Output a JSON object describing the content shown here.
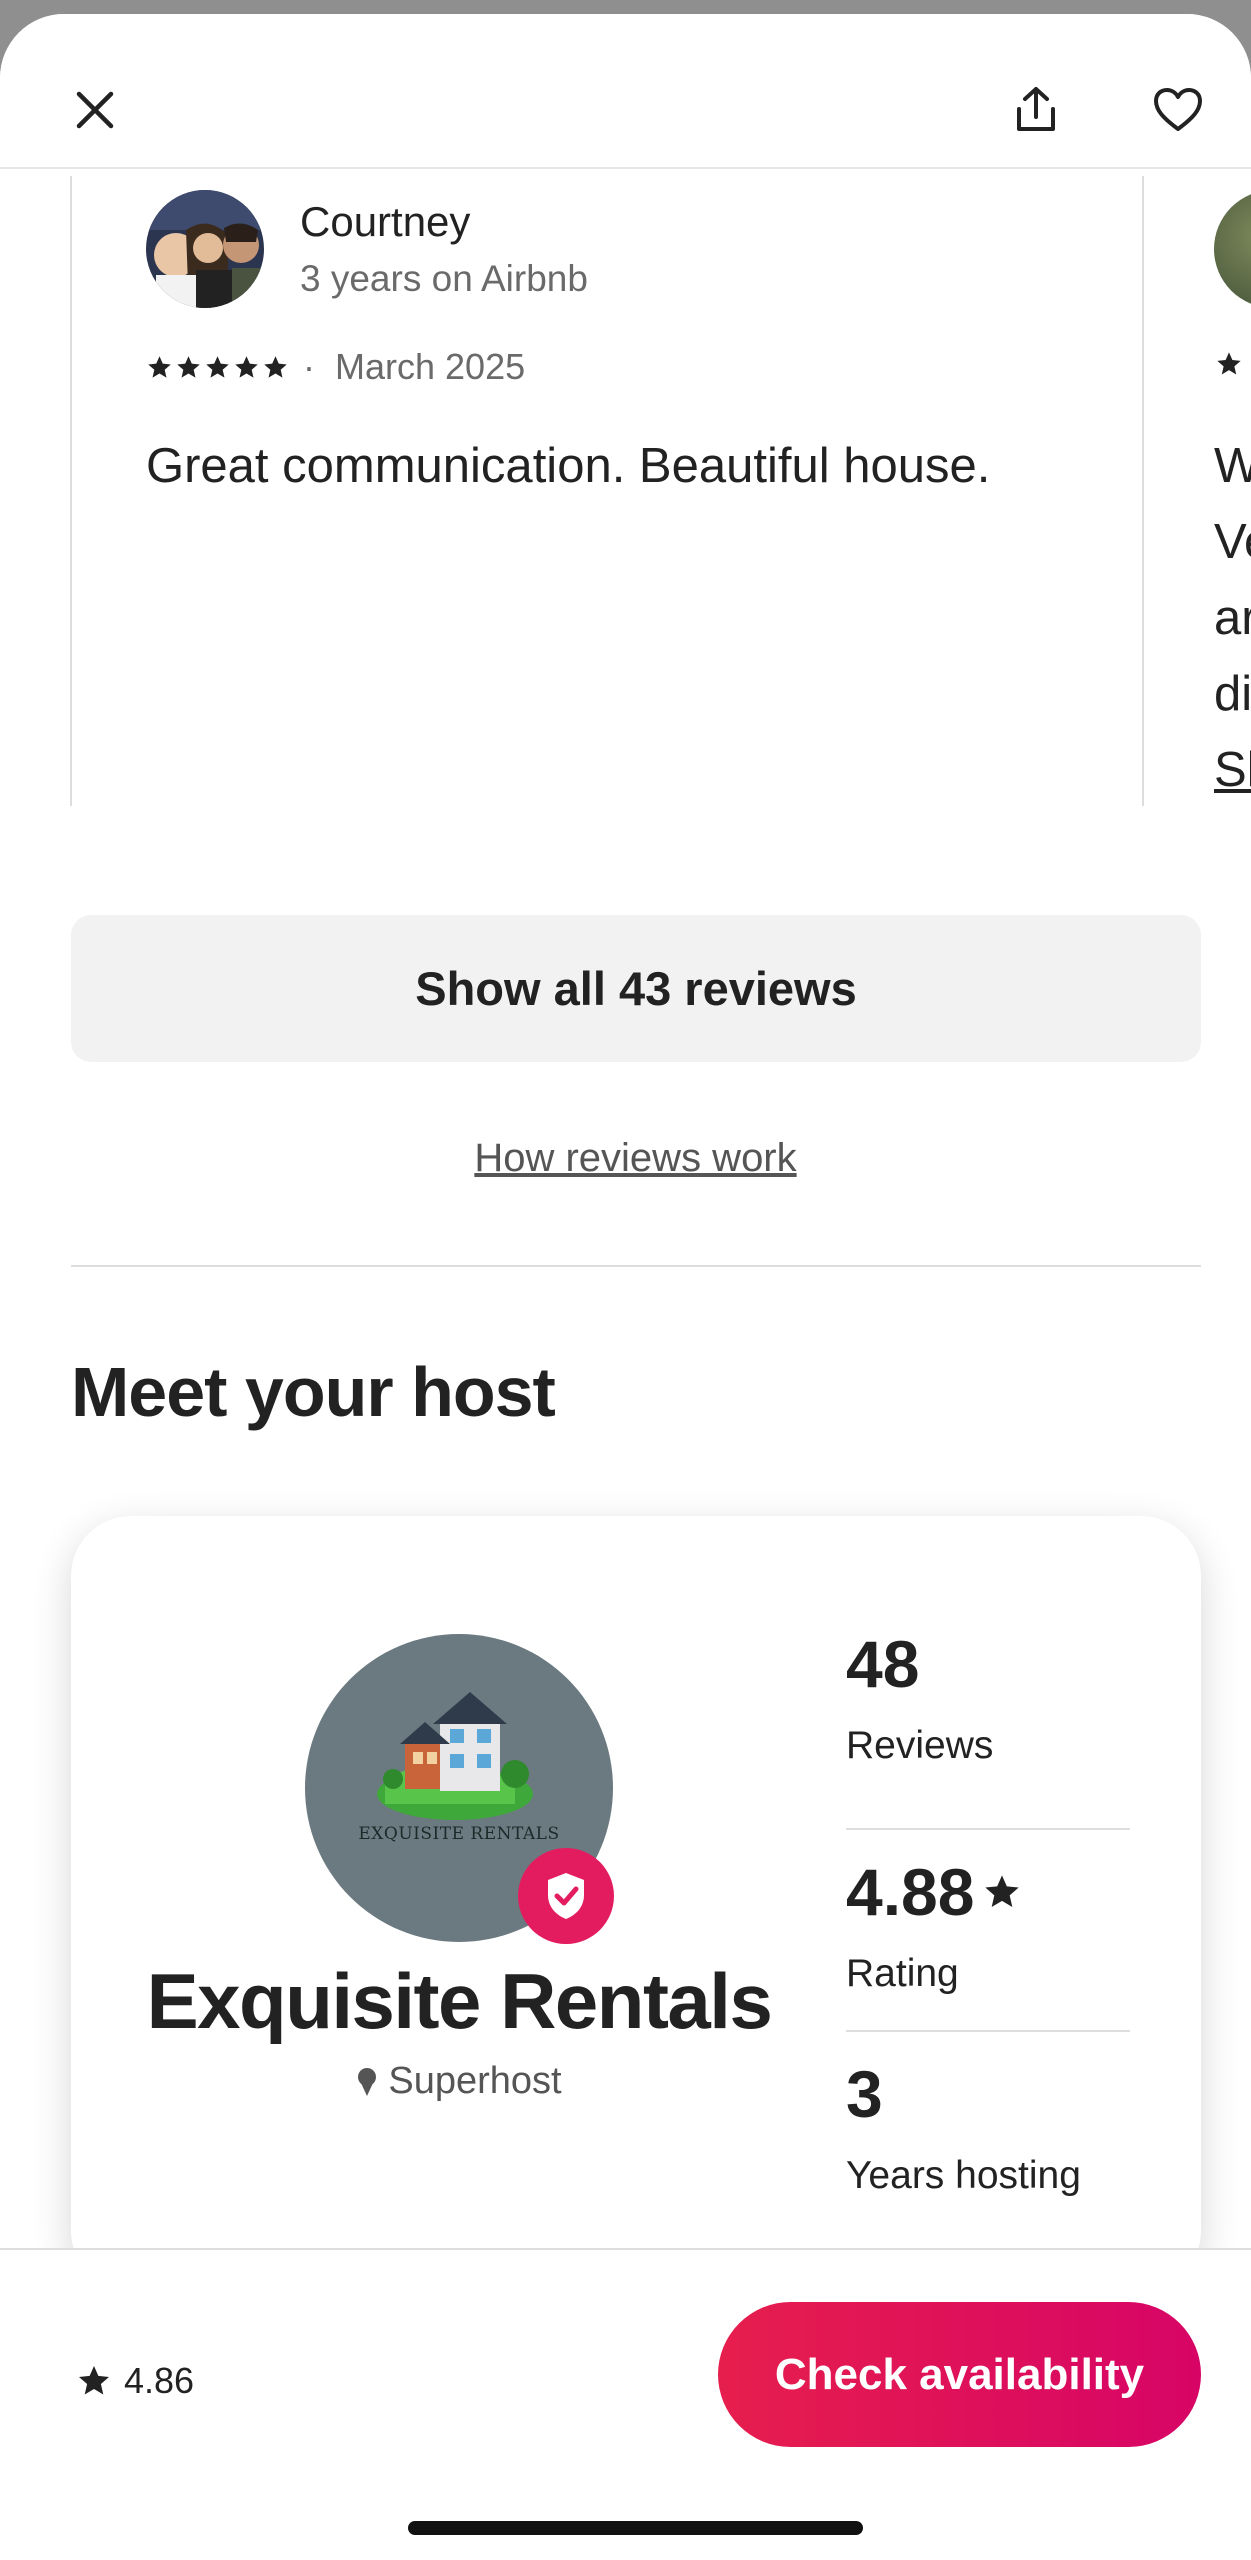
{
  "review": {
    "name": "Courtney",
    "tenure": "3 years on Airbnb",
    "date": "March 2025",
    "rating_stars": 5,
    "text": "Great communication. Beautiful house."
  },
  "peek_review": {
    "lines": [
      "W",
      "Ve",
      "ar",
      "di"
    ],
    "link": "Sh"
  },
  "reviews_section": {
    "show_all_label": "Show all 43 reviews",
    "how_reviews_work_label": "How reviews work"
  },
  "host_section": {
    "title": "Meet your host",
    "host_name": "Exquisite Rentals",
    "logo_text": "EXQUISITE RENTALS",
    "badge": "Superhost",
    "stats": [
      {
        "value": "48",
        "label": "Reviews"
      },
      {
        "value": "4.88",
        "label": "Rating"
      },
      {
        "value": "3",
        "label": "Years hosting"
      }
    ]
  },
  "booking_bar": {
    "rating": "4.86",
    "cta_label": "Check availability"
  },
  "colors": {
    "brand_accent": "#e31c5f",
    "cta_gradient_start": "#e61e4d",
    "cta_gradient_end": "#d70466",
    "text_primary": "#222222",
    "text_secondary": "#6a6a6a"
  },
  "icons": {
    "close": "close-icon",
    "share": "share-icon",
    "favorite": "heart-icon",
    "star": "star-icon",
    "verified": "shield-check-icon",
    "superhost": "superhost-medal-icon"
  }
}
